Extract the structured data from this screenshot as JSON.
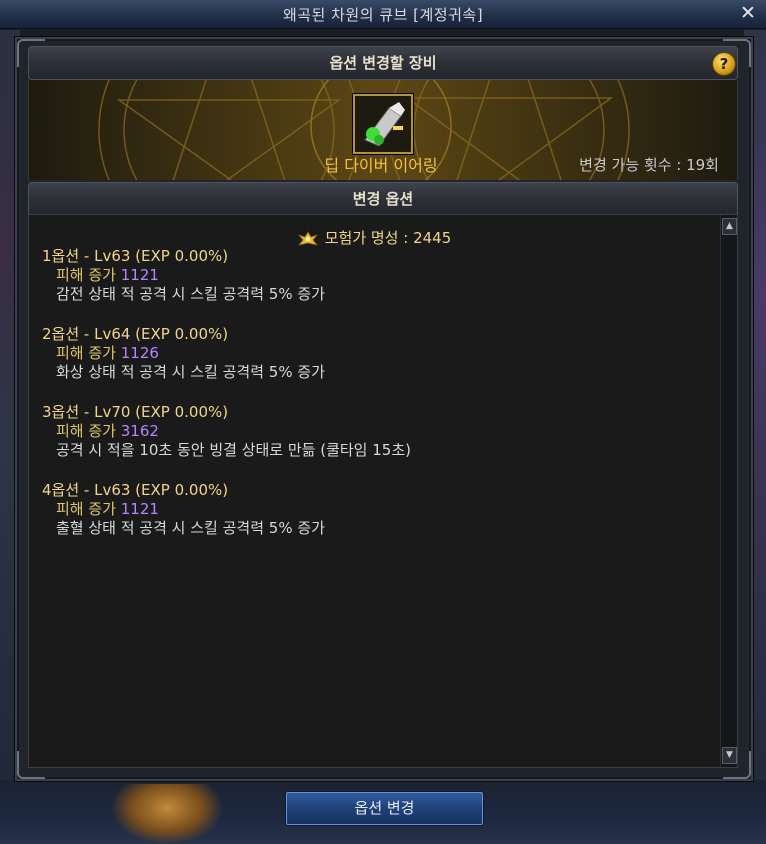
{
  "window": {
    "title": "왜곡된 차원의 큐브 [계정귀속]",
    "close_icon": "close-icon"
  },
  "equipment_section": {
    "header": "옵션 변경할 장비",
    "help_label": "?",
    "item_name": "딥 다이버 이어링",
    "change_count_text": "변경 가능 횟수 : 19회"
  },
  "options_section": {
    "header": "변경 옵션",
    "reputation_text": "모험가 명성 : 2445",
    "options": [
      {
        "head": "1옵션 - Lv63 (EXP 0.00%)",
        "damage_label": "피해 증가",
        "damage_value": "1121",
        "effect": "감전 상태 적 공격 시 스킬 공격력 5% 증가"
      },
      {
        "head": "2옵션 - Lv64 (EXP 0.00%)",
        "damage_label": "피해 증가",
        "damage_value": "1126",
        "effect": "화상 상태 적 공격 시 스킬 공격력 5% 증가"
      },
      {
        "head": "3옵션 - Lv70 (EXP 0.00%)",
        "damage_label": "피해 증가",
        "damage_value": "3162",
        "effect": "공격 시 적을 10초 동안 빙결 상태로 만듦 (쿨타임 15초)"
      },
      {
        "head": "4옵션 - Lv63 (EXP 0.00%)",
        "damage_label": "피해 증가",
        "damage_value": "1121",
        "effect": "출혈 상태 적 공격 시 스킬 공격력 5% 증가"
      }
    ]
  },
  "footer": {
    "change_button": "옵션 변경"
  },
  "colors": {
    "accent_gold": "#f1d58a",
    "item_name": "#f6c23e",
    "value_purple": "#b485ff",
    "button_blue": "#1f3f76"
  }
}
